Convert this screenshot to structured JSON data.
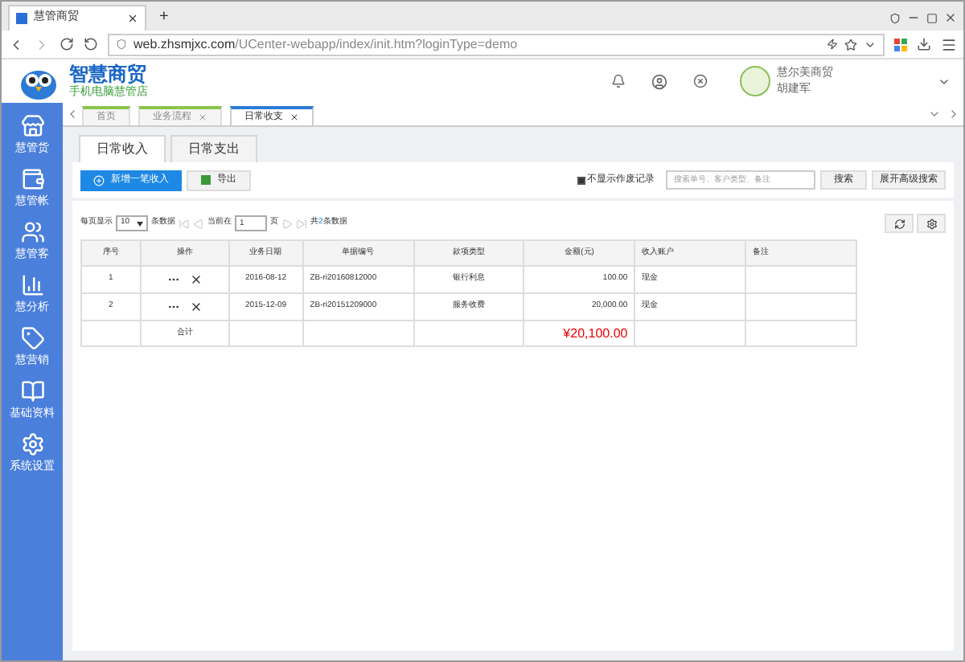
{
  "browser": {
    "tab_title": "慧管商贸",
    "new_tab": "+",
    "url_host": "web.zhsmjxc.com",
    "url_path": "/UCenter-webapp/index/init.htm?loginType=demo"
  },
  "brand": {
    "name": "智慧商贸",
    "slogan": "手机电脑慧管店"
  },
  "user": {
    "company": "慧尔美商贸",
    "name": "胡建军"
  },
  "sidebar": {
    "items": [
      {
        "label": "慧管货",
        "selected": false
      },
      {
        "label": "慧管帐",
        "selected": false
      },
      {
        "label": "慧管客",
        "selected": false
      },
      {
        "label": "慧分析",
        "selected": false
      },
      {
        "label": "慧营销",
        "selected": false
      },
      {
        "label": "基础资料",
        "selected": false
      },
      {
        "label": "系统设置",
        "selected": false
      }
    ]
  },
  "page_tabs": [
    {
      "label": "首页",
      "closable": false,
      "selected": false
    },
    {
      "label": "业务流程",
      "closable": true,
      "selected": false
    },
    {
      "label": "日常收支",
      "closable": true,
      "selected": true
    }
  ],
  "sub_tabs": [
    {
      "label": "日常收入",
      "selected": true
    },
    {
      "label": "日常支出",
      "selected": false
    }
  ],
  "toolbar": {
    "add_button": "新增一笔收入",
    "export_button": "导出",
    "hide_void": {
      "label": "不显示作废记录",
      "checked": true
    },
    "search": {
      "placeholder": "搜索单号、客户类型、备注"
    },
    "search_button": "搜索",
    "advanced_button": "展开高级搜索"
  },
  "pager": {
    "per_page_label": "每页显示",
    "per_page": "10",
    "records_label": "条数据",
    "current_label": "当前在",
    "current": "1",
    "page_label": "页",
    "total_prefix": "共",
    "total": "2",
    "total_suffix": "条数据"
  },
  "table": {
    "columns": [
      "序号",
      "操作",
      "业务日期",
      "单据编号",
      "款项类型",
      "金额(元)",
      "收入账户",
      "备注"
    ],
    "rows": [
      {
        "no": "1",
        "date": "2016-08-12",
        "doc": "ZB-ri20160812000",
        "type": "银行利息",
        "amount": "100.00",
        "account": "现金"
      },
      {
        "no": "2",
        "date": "2015-12-09",
        "doc": "ZB-ri20151209000",
        "type": "服务收费",
        "amount": "20,000.00",
        "account": "现金"
      }
    ],
    "total": {
      "label": "合计",
      "amount": "¥20,100.00"
    }
  }
}
